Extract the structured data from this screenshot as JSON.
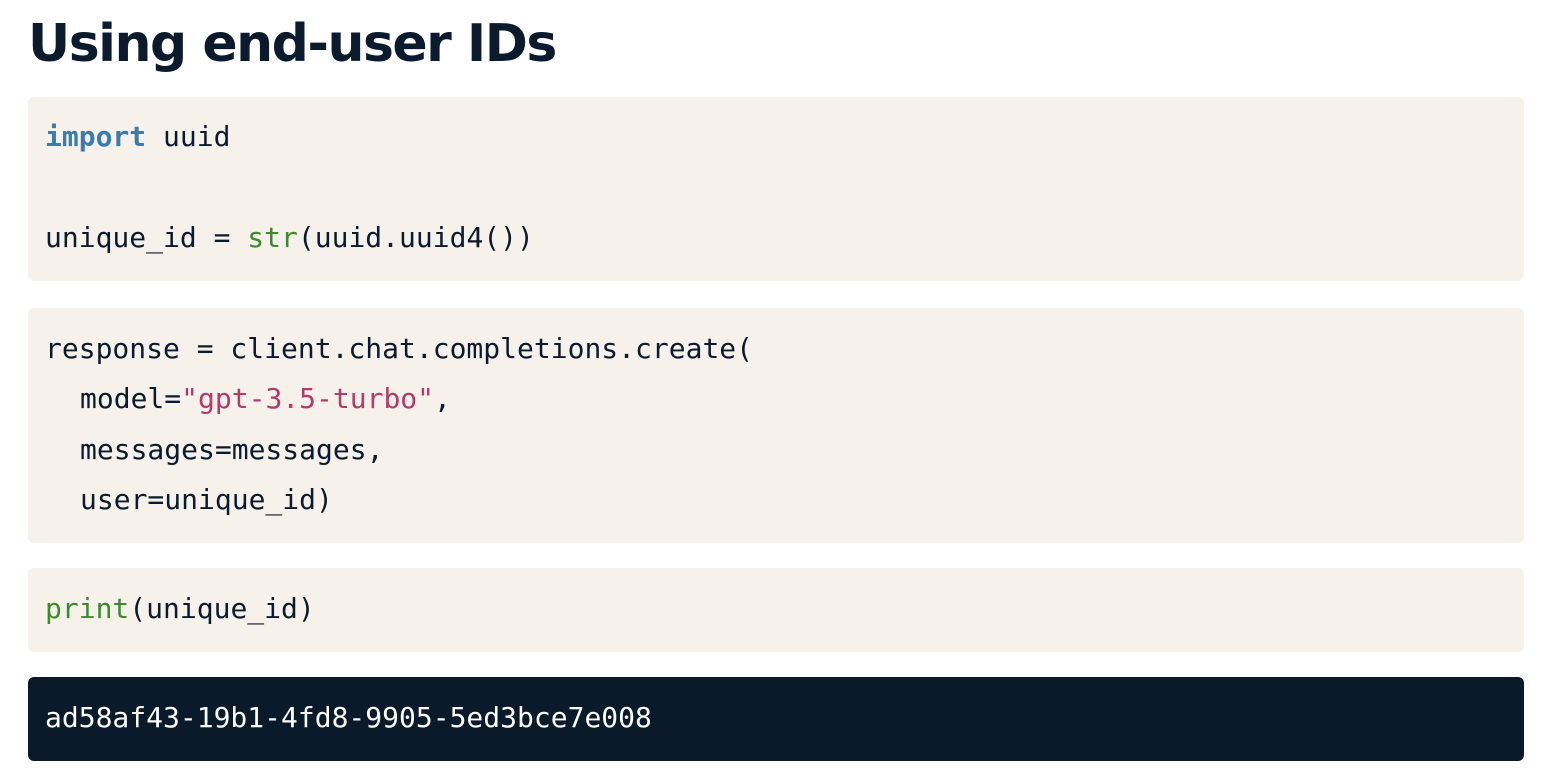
{
  "heading": "Using end-user IDs",
  "block1": {
    "line1": {
      "keyword": "import",
      "rest": " uuid"
    },
    "line3": {
      "pre": "unique_id = ",
      "builtin": "str",
      "post": "(uuid.uuid4())"
    }
  },
  "block2": {
    "line1": "response = client.chat.completions.create(",
    "line2": {
      "pre": "model=",
      "string": "\"gpt-3.5-turbo\"",
      "post": ","
    },
    "line3": "messages=messages,",
    "line4": "user=unique_id)"
  },
  "block3": {
    "line1": {
      "builtin": "print",
      "post": "(unique_id)"
    }
  },
  "output": {
    "line1": "ad58af43-19b1-4fd8-9905-5ed3bce7e008"
  },
  "colors": {
    "keyword": "#3a7cb0",
    "builtin": "#3d8a2a",
    "string": "#b33a6a",
    "code_bg": "#f6f1eb",
    "output_bg": "#0a1a2b",
    "text": "#0b1a2c"
  }
}
